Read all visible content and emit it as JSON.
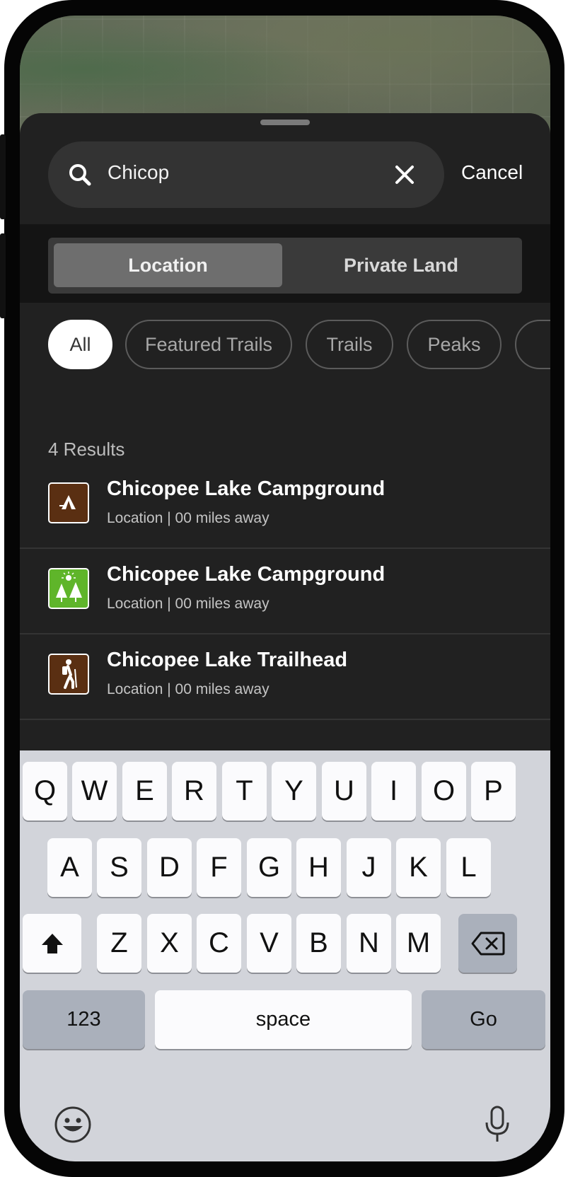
{
  "search": {
    "query": "Chicop",
    "cancel_label": "Cancel"
  },
  "segments": [
    {
      "label": "Location",
      "selected": true
    },
    {
      "label": "Private Land",
      "selected": false
    }
  ],
  "filters": [
    {
      "label": "All",
      "selected": true
    },
    {
      "label": "Featured Trails",
      "selected": false
    },
    {
      "label": "Trails",
      "selected": false
    },
    {
      "label": "Peaks",
      "selected": false
    }
  ],
  "results": {
    "count_label": "4 Results",
    "items": [
      {
        "title": "Chicopee Lake Campground",
        "subtitle": "Location | 00 miles away",
        "icon": "campground-tent-icon",
        "icon_color": "#5a2f12"
      },
      {
        "title": "Chicopee Lake Campground",
        "subtitle": "Location | 00 miles away",
        "icon": "forest-sun-icon",
        "icon_color": "#5fb52a"
      },
      {
        "title": "Chicopee Lake Trailhead",
        "subtitle": "Location | 00 miles away",
        "icon": "hiker-icon",
        "icon_color": "#5a2f12"
      }
    ]
  },
  "keyboard": {
    "row1": [
      "Q",
      "W",
      "E",
      "R",
      "T",
      "Y",
      "U",
      "I",
      "O",
      "P"
    ],
    "row2": [
      "A",
      "S",
      "D",
      "F",
      "G",
      "H",
      "J",
      "K",
      "L"
    ],
    "row3": [
      "Z",
      "X",
      "C",
      "V",
      "B",
      "N",
      "M"
    ],
    "numbers_label": "123",
    "space_label": "space",
    "go_label": "Go",
    "icons": [
      "shift-icon",
      "backspace-icon",
      "emoji-icon",
      "microphone-icon"
    ]
  },
  "colors": {
    "sheet_background": "#212121",
    "keyboard_background": "#d2d4da",
    "chip_selected": "#ffffff"
  }
}
